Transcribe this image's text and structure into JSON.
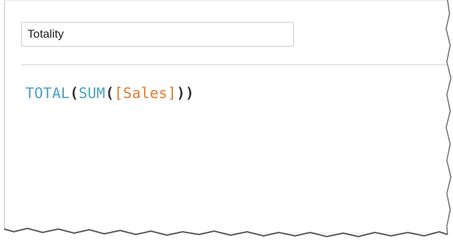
{
  "calc_editor": {
    "name_value": "Totality",
    "formula": {
      "outer_function": "TOTAL",
      "open_paren_1": "(",
      "inner_function": "SUM",
      "open_paren_2": "(",
      "field": "[Sales]",
      "close_parens": "))"
    }
  },
  "colors": {
    "function": "#4aa0c4",
    "field": "#e07a2e",
    "paren": "#333333"
  }
}
